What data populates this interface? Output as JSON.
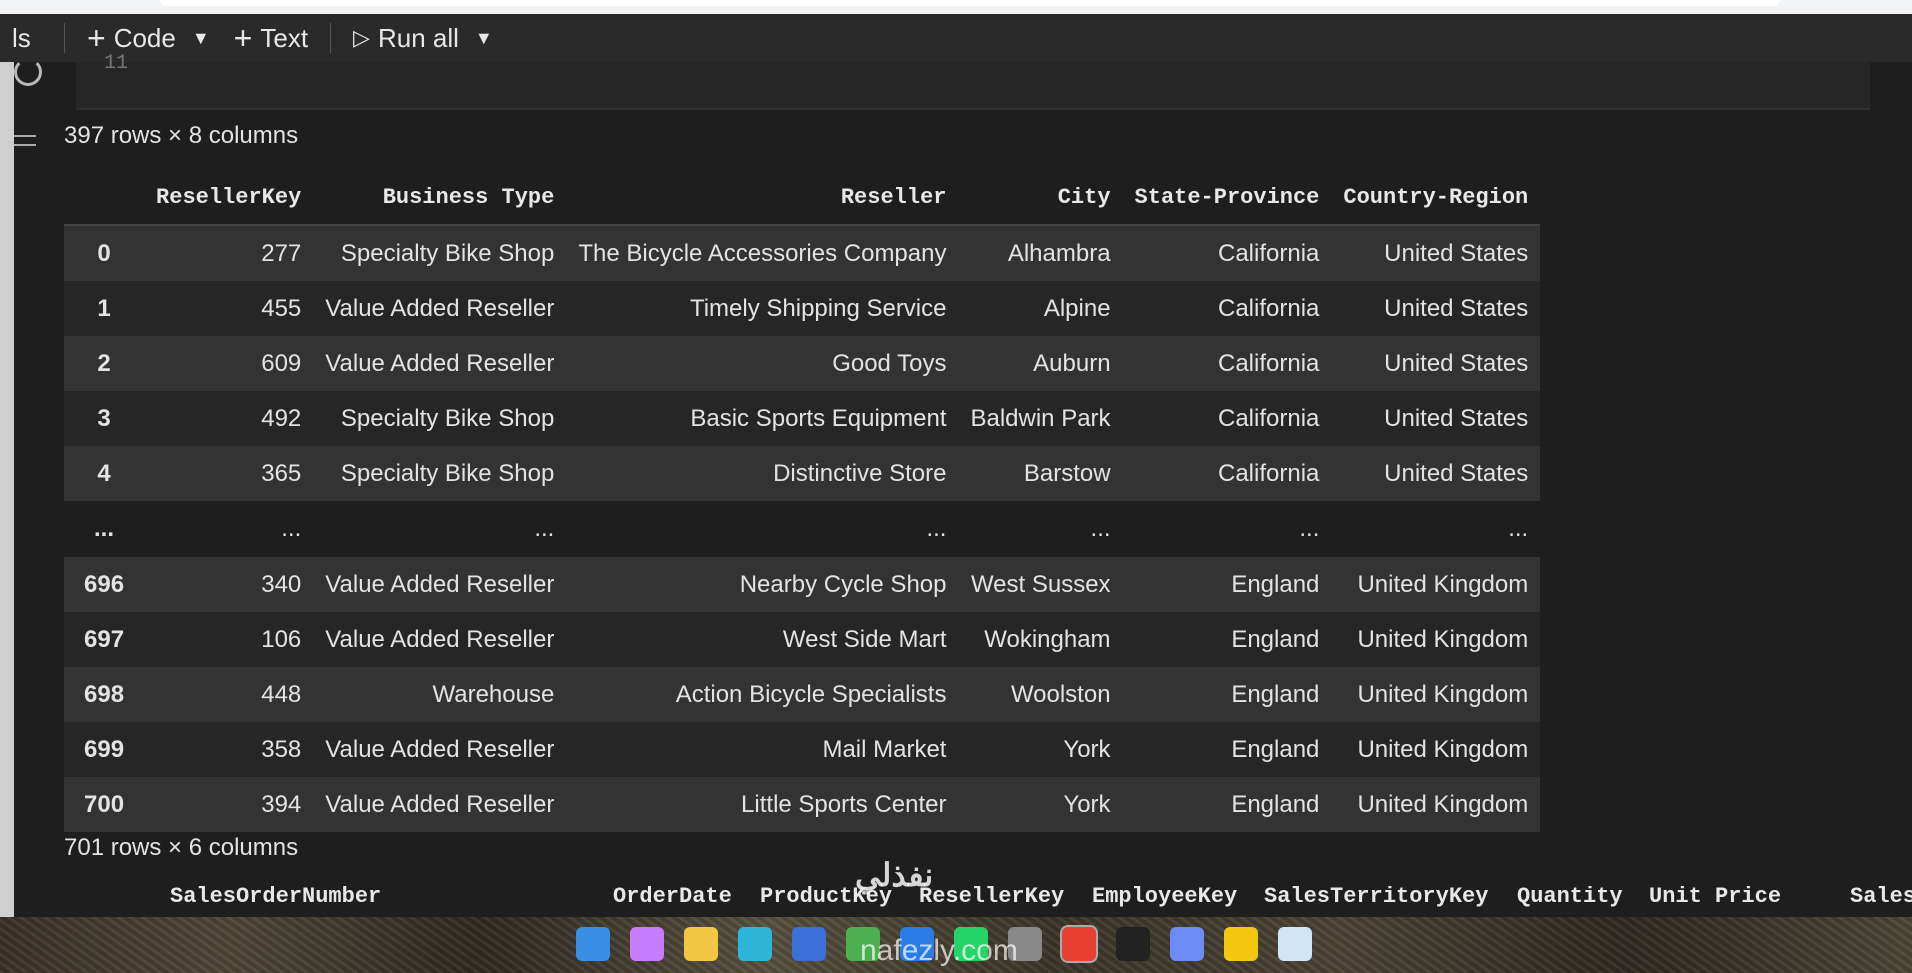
{
  "toolbar": {
    "partial_label": "ls",
    "code_label": "Code",
    "text_label": "Text",
    "run_all_label": "Run all"
  },
  "code_cell": {
    "line_number": "11"
  },
  "output": {
    "shape_top": "397 rows × 8 columns",
    "shape_bottom": "701 rows × 6 columns",
    "columns": [
      "ResellerKey",
      "Business Type",
      "Reseller",
      "City",
      "State-Province",
      "Country-Region"
    ],
    "rows": [
      {
        "idx": "0",
        "cells": [
          "277",
          "Specialty Bike Shop",
          "The Bicycle Accessories Company",
          "Alhambra",
          "California",
          "United States"
        ]
      },
      {
        "idx": "1",
        "cells": [
          "455",
          "Value Added Reseller",
          "Timely Shipping Service",
          "Alpine",
          "California",
          "United States"
        ]
      },
      {
        "idx": "2",
        "cells": [
          "609",
          "Value Added Reseller",
          "Good Toys",
          "Auburn",
          "California",
          "United States"
        ]
      },
      {
        "idx": "3",
        "cells": [
          "492",
          "Specialty Bike Shop",
          "Basic Sports Equipment",
          "Baldwin Park",
          "California",
          "United States"
        ]
      },
      {
        "idx": "4",
        "cells": [
          "365",
          "Specialty Bike Shop",
          "Distinctive Store",
          "Barstow",
          "California",
          "United States"
        ]
      },
      {
        "idx": "...",
        "cells": [
          "...",
          "...",
          "...",
          "...",
          "...",
          "..."
        ]
      },
      {
        "idx": "696",
        "cells": [
          "340",
          "Value Added Reseller",
          "Nearby Cycle Shop",
          "West Sussex",
          "England",
          "United Kingdom"
        ]
      },
      {
        "idx": "697",
        "cells": [
          "106",
          "Value Added Reseller",
          "West Side Mart",
          "Wokingham",
          "England",
          "United Kingdom"
        ]
      },
      {
        "idx": "698",
        "cells": [
          "448",
          "Warehouse",
          "Action Bicycle Specialists",
          "Woolston",
          "England",
          "United Kingdom"
        ]
      },
      {
        "idx": "699",
        "cells": [
          "358",
          "Value Added Reseller",
          "Mail Market",
          "York",
          "England",
          "United Kingdom"
        ]
      },
      {
        "idx": "700",
        "cells": [
          "394",
          "Value Added Reseller",
          "Little Sports Center",
          "York",
          "England",
          "United Kingdom"
        ]
      }
    ],
    "next_columns": [
      "SalesOrderNumber",
      "OrderDate",
      "ProductKey",
      "ResellerKey",
      "EmployeeKey",
      "SalesTerritoryKey",
      "Quantity",
      "Unit Price",
      "Sales"
    ]
  },
  "watermark": {
    "arabic": "نفذلي",
    "domain": "nafezly.com"
  },
  "taskbar": {
    "icons": [
      {
        "name": "windows-start-icon",
        "color": "#3a8ee6"
      },
      {
        "name": "copilot-icon",
        "color": "#c77dff"
      },
      {
        "name": "file-explorer-icon",
        "color": "#f2c744"
      },
      {
        "name": "edge-icon",
        "color": "#2fb5d9"
      },
      {
        "name": "microsoft-store-icon",
        "color": "#3d6fd8"
      },
      {
        "name": "people-icon",
        "color": "#4caf50"
      },
      {
        "name": "outlook-icon",
        "color": "#2a7be4"
      },
      {
        "name": "whatsapp-icon",
        "color": "#25d366"
      },
      {
        "name": "app-icon",
        "color": "#888888"
      },
      {
        "name": "chrome-icon",
        "color": "#e94235"
      },
      {
        "name": "chatgpt-icon",
        "color": "#222222"
      },
      {
        "name": "gemini-icon",
        "color": "#6e8cf5"
      },
      {
        "name": "power-bi-icon",
        "color": "#f2c811"
      },
      {
        "name": "snowflake-icon",
        "color": "#cfe6f7"
      }
    ]
  }
}
